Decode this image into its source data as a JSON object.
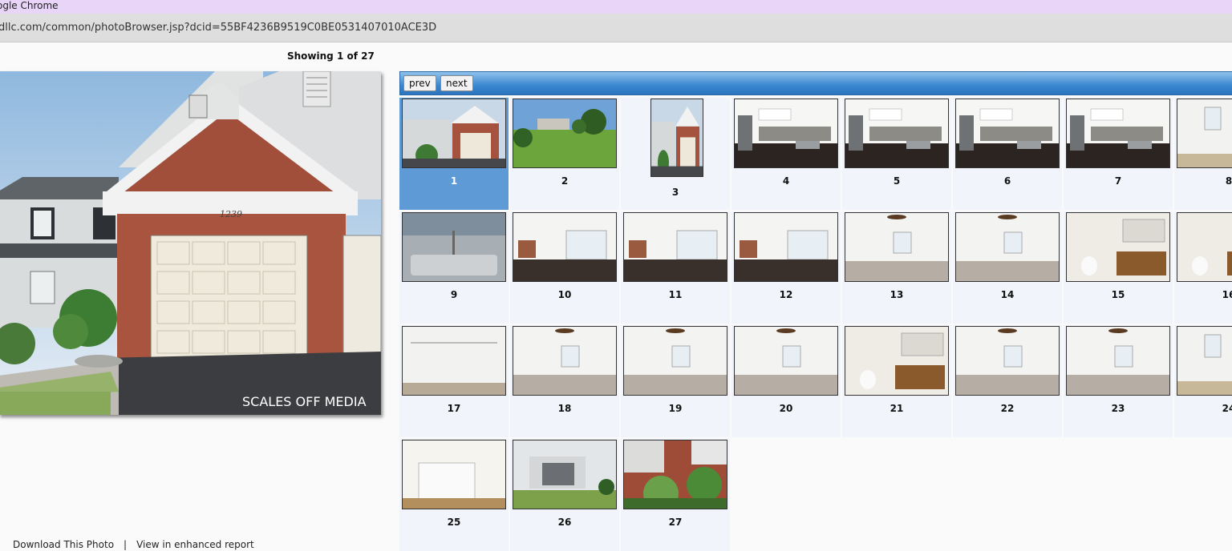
{
  "browser": {
    "title": "ogle Chrome",
    "url": "dllc.com/common/photoBrowser.jsp?dcid=55BF4236B9519C0BE0531407010ACE3D"
  },
  "viewer": {
    "showing_text": "Showing 1 of 27",
    "house_number": "1239",
    "watermark": "SCALES OFF MEDIA"
  },
  "gallery": {
    "prev_label": "prev",
    "next_label": "next",
    "selected": 1,
    "thumbs": [
      {
        "n": "1",
        "scene": "exterior"
      },
      {
        "n": "2",
        "scene": "yard"
      },
      {
        "n": "3",
        "scene": "exterior"
      },
      {
        "n": "4",
        "scene": "kitchen"
      },
      {
        "n": "5",
        "scene": "kitchen"
      },
      {
        "n": "6",
        "scene": "kitchen"
      },
      {
        "n": "7",
        "scene": "kitchen"
      },
      {
        "n": "8",
        "scene": "room"
      },
      {
        "n": "9",
        "scene": "sink"
      },
      {
        "n": "10",
        "scene": "living"
      },
      {
        "n": "11",
        "scene": "living"
      },
      {
        "n": "12",
        "scene": "living"
      },
      {
        "n": "13",
        "scene": "bedroom"
      },
      {
        "n": "14",
        "scene": "bedroom"
      },
      {
        "n": "15",
        "scene": "bath"
      },
      {
        "n": "16",
        "scene": "bath"
      },
      {
        "n": "17",
        "scene": "closet"
      },
      {
        "n": "18",
        "scene": "bedroom"
      },
      {
        "n": "19",
        "scene": "bedroom"
      },
      {
        "n": "20",
        "scene": "bedroom"
      },
      {
        "n": "21",
        "scene": "bath"
      },
      {
        "n": "22",
        "scene": "bedroom"
      },
      {
        "n": "23",
        "scene": "bedroom"
      },
      {
        "n": "24",
        "scene": "room"
      },
      {
        "n": "25",
        "scene": "laundry"
      },
      {
        "n": "26",
        "scene": "patio"
      },
      {
        "n": "27",
        "scene": "garden"
      }
    ]
  },
  "footer": {
    "download_label": "Download This Photo",
    "separator": "|",
    "enhanced_label": "View in enhanced report"
  },
  "colors": {
    "toolbar_blue": "#3a86cf",
    "selected_cell": "#5d9ad6",
    "cell_bg": "#f1f5fb",
    "titlebar": "#e8d5f7"
  }
}
